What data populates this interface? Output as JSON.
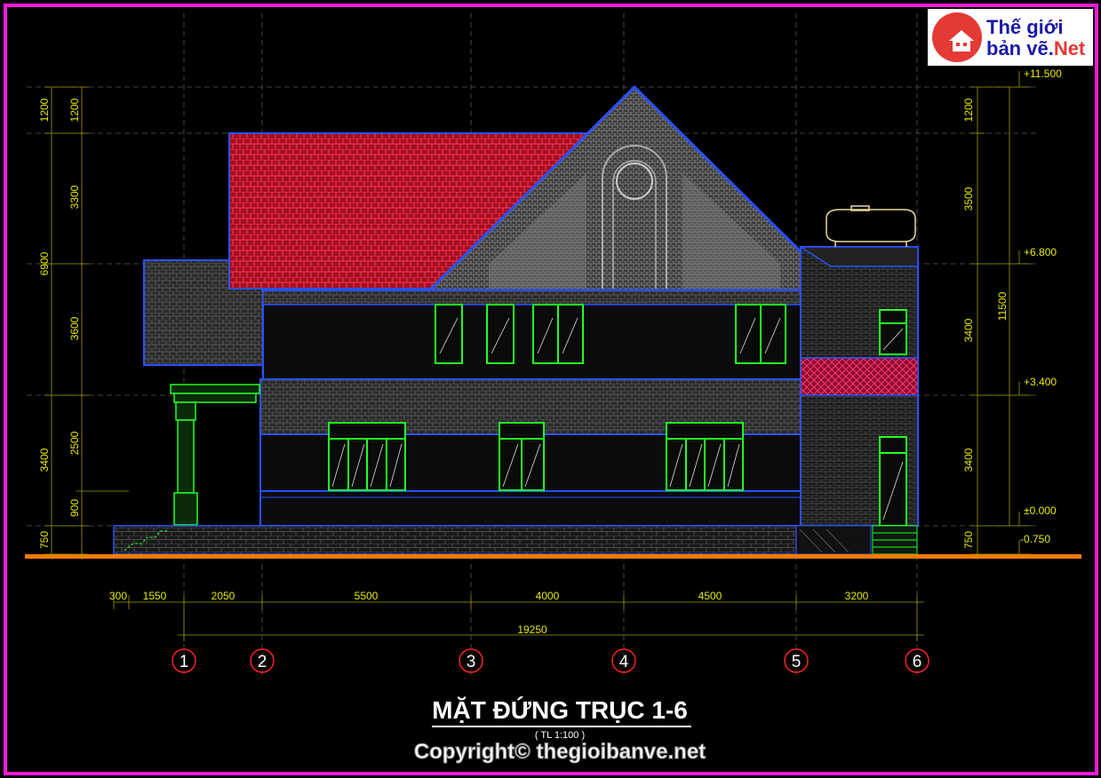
{
  "drawing": {
    "title": "MẶT ĐỨNG TRỤC 1-6",
    "scale": "( TL 1:100 )",
    "copyright": "Copyright© thegioibanve.net"
  },
  "logo": {
    "line1": "Thế giới",
    "line2_a": "bản vẽ.",
    "line2_b": "Net"
  },
  "levels": [
    "+11.500",
    "+6.800",
    "+3.400",
    "±0.000",
    "-0.750"
  ],
  "dims_left_outer": [
    "1200",
    "6900",
    "3400",
    "750"
  ],
  "dims_left_inner": [
    "1200",
    "3300",
    "3600",
    "2500",
    "900"
  ],
  "dims_right_inner": [
    "1200",
    "3500",
    "3400",
    "3400",
    "750"
  ],
  "dims_right_total": "11500",
  "dims_bottom": [
    "300",
    "1550",
    "2050",
    "5500",
    "4000",
    "4500",
    "3200"
  ],
  "dims_bottom_total": "19250",
  "axes": [
    "1",
    "2",
    "3",
    "4",
    "5",
    "6"
  ],
  "colors": {
    "frame": "#ff1ad9",
    "dimension": "#e8e800",
    "outline": "#2a52ff",
    "window": "#22ff22",
    "roof_red": "#c8102e",
    "ground": "#ff7a00"
  }
}
